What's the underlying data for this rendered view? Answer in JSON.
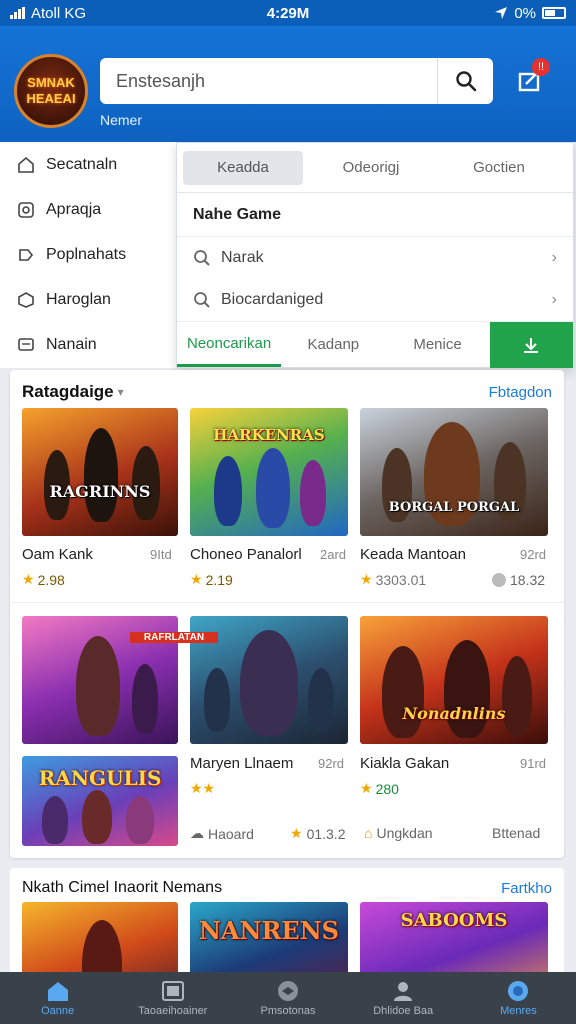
{
  "status_bar": {
    "carrier": "Atoll KG",
    "time": "4:29M",
    "battery": "0%"
  },
  "header": {
    "logo_line1": "SMNAK",
    "logo_line2": "HEAEAI",
    "search_placeholder": "Enstesanjh",
    "subtitle": "Nemer",
    "notification_count": "!!",
    "accent_color": "#1573d6"
  },
  "side_menu": {
    "items": [
      {
        "label": "Secatnaln",
        "icon": "home-icon"
      },
      {
        "label": "Apraqja",
        "icon": "gear-icon"
      },
      {
        "label": "Poplnahats",
        "icon": "tag-icon"
      },
      {
        "label": "Haroglan",
        "icon": "box-icon"
      },
      {
        "label": "Nanain",
        "icon": "message-icon"
      }
    ]
  },
  "dropdown": {
    "tabs": [
      "Keadda",
      "Odeorigj",
      "Goctien"
    ],
    "title": "Nahe Game",
    "rows": [
      {
        "label": "Narak"
      },
      {
        "label": "Biocardaniged"
      }
    ],
    "bottom_tabs": [
      "Neoncarikan",
      "Kadanp",
      "Menice"
    ],
    "go_color": "#21a34b"
  },
  "section1": {
    "title": "Ratagdaige",
    "link": "Fbtagdon"
  },
  "games": [
    {
      "title": "Oam Kank",
      "size": "9Itd",
      "rating": "2.98",
      "art": "RAGRINNS"
    },
    {
      "title": "Choneo Panalorl",
      "size": "2ard",
      "rating": "2.19",
      "art": "HARKENRAS"
    },
    {
      "title": "Keada Mantoan",
      "size": "92rd",
      "rating": "3303.01",
      "extra": "18.32",
      "art": "BORGAL PORGAL"
    },
    {
      "title": "Maryen Llnaem",
      "size": "92rd",
      "rating": "",
      "art": "RAFRLATAN"
    },
    {
      "title": "Kiakla Gakan",
      "size": "91rd",
      "rating": "280",
      "art": "Nonadnlins"
    },
    {
      "title": "",
      "size": "",
      "rating": "",
      "art": "RANGULIS"
    }
  ],
  "card_footer": {
    "item1": "Haoard",
    "item2": "01.3.2",
    "item3": "Ungkdan",
    "item4": "Bttenad"
  },
  "section2": {
    "title": "Nkath Cimel Inaorit Nemans",
    "link": "Fartkho",
    "arts": [
      "",
      "NANRENS",
      "SABOOMS"
    ]
  },
  "bottom_nav": [
    {
      "label": "Oanne",
      "icon": "home-icon"
    },
    {
      "label": "Taoaeihoainer",
      "icon": "library-icon"
    },
    {
      "label": "Pmsotonas",
      "icon": "badge-icon"
    },
    {
      "label": "Dhlidoe Baa",
      "icon": "user-icon"
    },
    {
      "label": "Menres",
      "icon": "settings-icon"
    }
  ]
}
